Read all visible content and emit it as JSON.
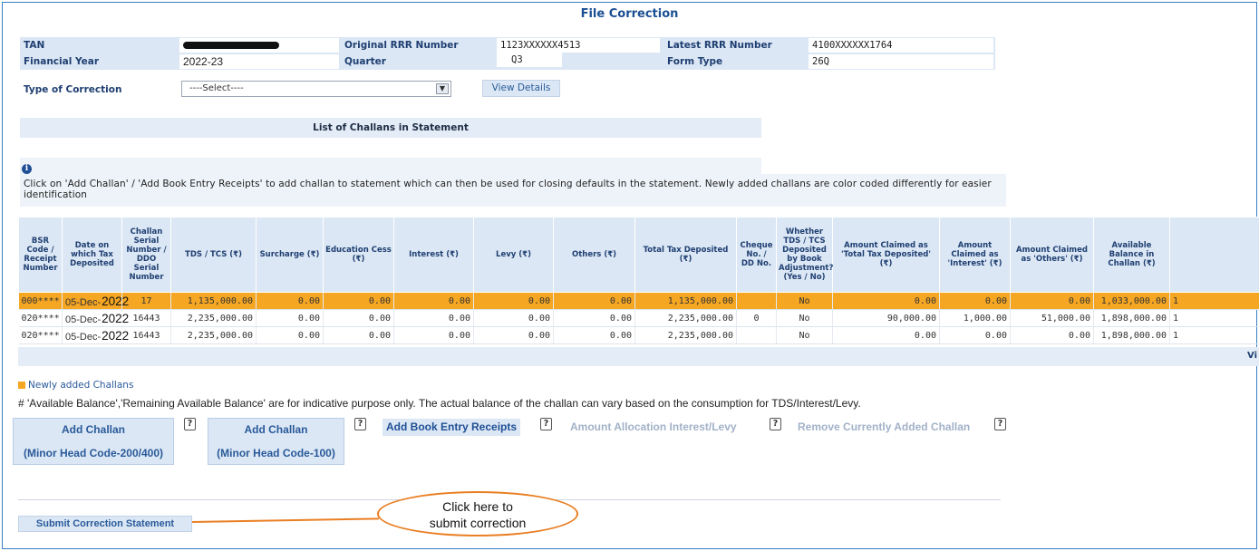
{
  "page": {
    "title": "File Correction"
  },
  "info": {
    "tan_label": "TAN",
    "original_rrr_label": "Original RRR Number",
    "original_rrr_value": "1123XXXXXX4513",
    "latest_rrr_label": "Latest RRR Number",
    "latest_rrr_value": "4100XXXXXX1764",
    "fy_label": "Financial Year",
    "fy_value": "2022-23",
    "quarter_label": "Quarter",
    "quarter_value": "Q3",
    "form_type_label": "Form Type",
    "form_type_value": "26Q"
  },
  "correction": {
    "type_label": "Type of Correction",
    "select_value": "----Select----",
    "view_details_label": "View Details"
  },
  "list": {
    "title": "List of Challans in Statement",
    "info_icon": "info-icon",
    "note": "Click on 'Add Challan' / 'Add Book Entry Receipts' to add challan to statement which can then be used for closing defaults in the statement. Newly added challans are color coded differently for easier identification"
  },
  "table": {
    "headers": [
      "BSR Code / Receipt Number",
      "Date on which Tax Deposited",
      "Challan Serial Number / DDO Serial Number",
      "TDS / TCS (₹)",
      "Surcharge (₹)",
      "Education Cess (₹)",
      "Interest (₹)",
      "Levy (₹)",
      "Others (₹)",
      "Total Tax Deposited (₹)",
      "Cheque No. / DD No.",
      "Whether TDS / TCS Deposited by Book Adjustment? (Yes / No)",
      "Amount Claimed as 'Total Tax Deposited' (₹)",
      "Amount Claimed as 'Interest' (₹)",
      "Amount Claimed as 'Others' (₹)",
      "Available Balance in Challan (₹)",
      ""
    ],
    "rows": [
      {
        "bsr": "000****",
        "date_day": "05-Dec-",
        "date_year": "2022",
        "serial": "17",
        "tds": "1,135,000.00",
        "surcharge": "0.00",
        "cess": "0.00",
        "interest": "0.00",
        "levy": "0.00",
        "others": "0.00",
        "total": "1,135,000.00",
        "cheque": "",
        "book": "No",
        "claimed_total": "0.00",
        "claimed_interest": "0.00",
        "claimed_others": "0.00",
        "available": "1,033,000.00",
        "tail": "1"
      },
      {
        "bsr": "020****",
        "date_day": "05-Dec-",
        "date_year": "2022",
        "serial": "16443",
        "tds": "2,235,000.00",
        "surcharge": "0.00",
        "cess": "0.00",
        "interest": "0.00",
        "levy": "0.00",
        "others": "0.00",
        "total": "2,235,000.00",
        "cheque": "0",
        "book": "No",
        "claimed_total": "90,000.00",
        "claimed_interest": "1,000.00",
        "claimed_others": "51,000.00",
        "available": "1,898,000.00",
        "tail": "1"
      },
      {
        "bsr": "020****",
        "date_day": "05-Dec-",
        "date_year": "2022",
        "serial": "16443",
        "tds": "2,235,000.00",
        "surcharge": "0.00",
        "cess": "0.00",
        "interest": "0.00",
        "levy": "0.00",
        "others": "0.00",
        "total": "2,235,000.00",
        "cheque": "",
        "book": "No",
        "claimed_total": "0.00",
        "claimed_interest": "0.00",
        "claimed_others": "0.00",
        "available": "1,898,000.00",
        "tail": "1"
      }
    ],
    "scroll_tail": "Vi"
  },
  "legend": {
    "label": "Newly added Challans",
    "color": "#f5a623"
  },
  "footnote": "# 'Available Balance','Remaining Available Balance' are for indicative purpose only. The actual balance of the challan can vary based on the consumption for TDS/Interest/Levy.",
  "actions": {
    "add_challan_line1": "Add Challan",
    "add_challan_200_line2": "(Minor Head Code-200/400)",
    "add_challan_100_line2": "(Minor Head Code-100)",
    "add_book_entry": "Add Book Entry Receipts",
    "amount_allocation": "Amount Allocation Interest/Levy",
    "remove_added": "Remove Currently Added Challan",
    "help_glyph": "?",
    "help_icon": "help-icon"
  },
  "submit": {
    "label": "Submit Correction Statement"
  },
  "callout": {
    "line1": "Click here to",
    "line2": "submit correction",
    "color": "#e97e22"
  }
}
